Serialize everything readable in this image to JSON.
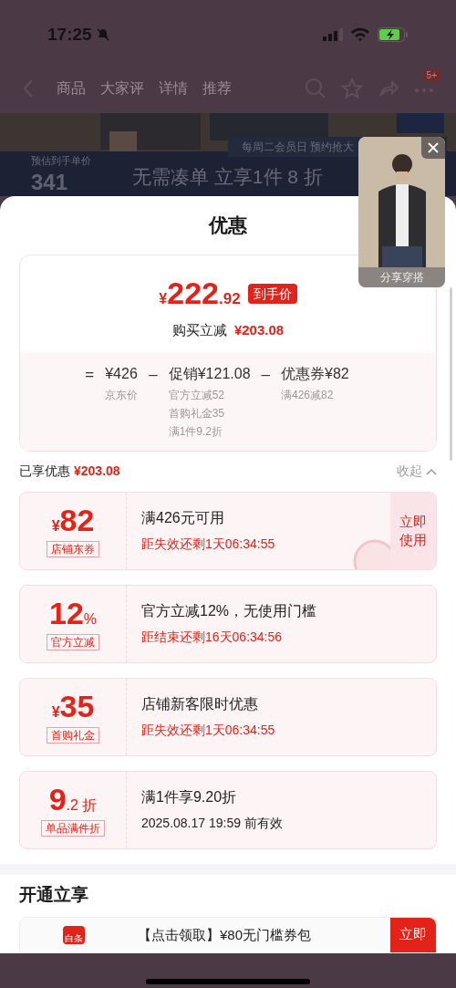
{
  "status_bar": {
    "time": "17:25"
  },
  "nav": {
    "tabs": [
      "商品",
      "大家评",
      "详情",
      "推荐"
    ],
    "badge": "5+"
  },
  "banner": {
    "notice": "每周二会员日 预约抢大",
    "price_label": "预估到手单价",
    "price": "341",
    "slogan": "无需凑单 立享1件 8 折"
  },
  "video": {
    "caption": "分享穿搭"
  },
  "sheet": {
    "title": "优惠",
    "summary": {
      "currency": "¥",
      "price_int": "222",
      "price_dec": ".92",
      "badge": "到手价",
      "saving_label": "购买立减",
      "saving": "¥203.08",
      "breakdown": [
        {
          "op": "=",
          "amount": "¥426",
          "notes": [
            "京东价"
          ]
        },
        {
          "op": "–",
          "amount": "促销¥121.08",
          "notes": [
            "官方立减52",
            "首购礼金35",
            "满1件9.2折"
          ]
        },
        {
          "op": "–",
          "amount": "优惠券¥82",
          "notes": [
            "满426减82"
          ]
        }
      ]
    },
    "enjoyed": {
      "label": "已享优惠",
      "amount": "¥203.08",
      "toggle": "收起"
    },
    "coupons": [
      {
        "kind": "amount",
        "prefix": "¥",
        "value": "82",
        "tag": "店铺东券",
        "title": "满426元可用",
        "note": "距失效还剩1天06:34:55",
        "urgent": true,
        "action": "立即使用",
        "claimed": true
      },
      {
        "kind": "percent",
        "value": "12",
        "suffix": "%",
        "tag": "官方立减",
        "title": "官方立减12%，无使用门槛",
        "note": "距结束还剩16天06:34:56",
        "urgent": true,
        "claimed": false
      },
      {
        "kind": "amount",
        "prefix": "¥",
        "value": "35",
        "tag": "首购礼金",
        "title": "店铺新客限时优惠",
        "note": "距失效还剩1天06:34:55",
        "urgent": true,
        "claimed": false
      },
      {
        "kind": "percent",
        "value": "9",
        "suffix": ".2 折",
        "tag": "单品满件折",
        "title": "满1件享9.20折",
        "note": "2025.08.17 19:59 前有效",
        "urgent": false,
        "claimed": false
      }
    ],
    "section": {
      "title": "开通立享",
      "card": {
        "icon_label": "白条",
        "title": "【点击领取】¥80无门槛券包",
        "action": "立即"
      }
    }
  }
}
